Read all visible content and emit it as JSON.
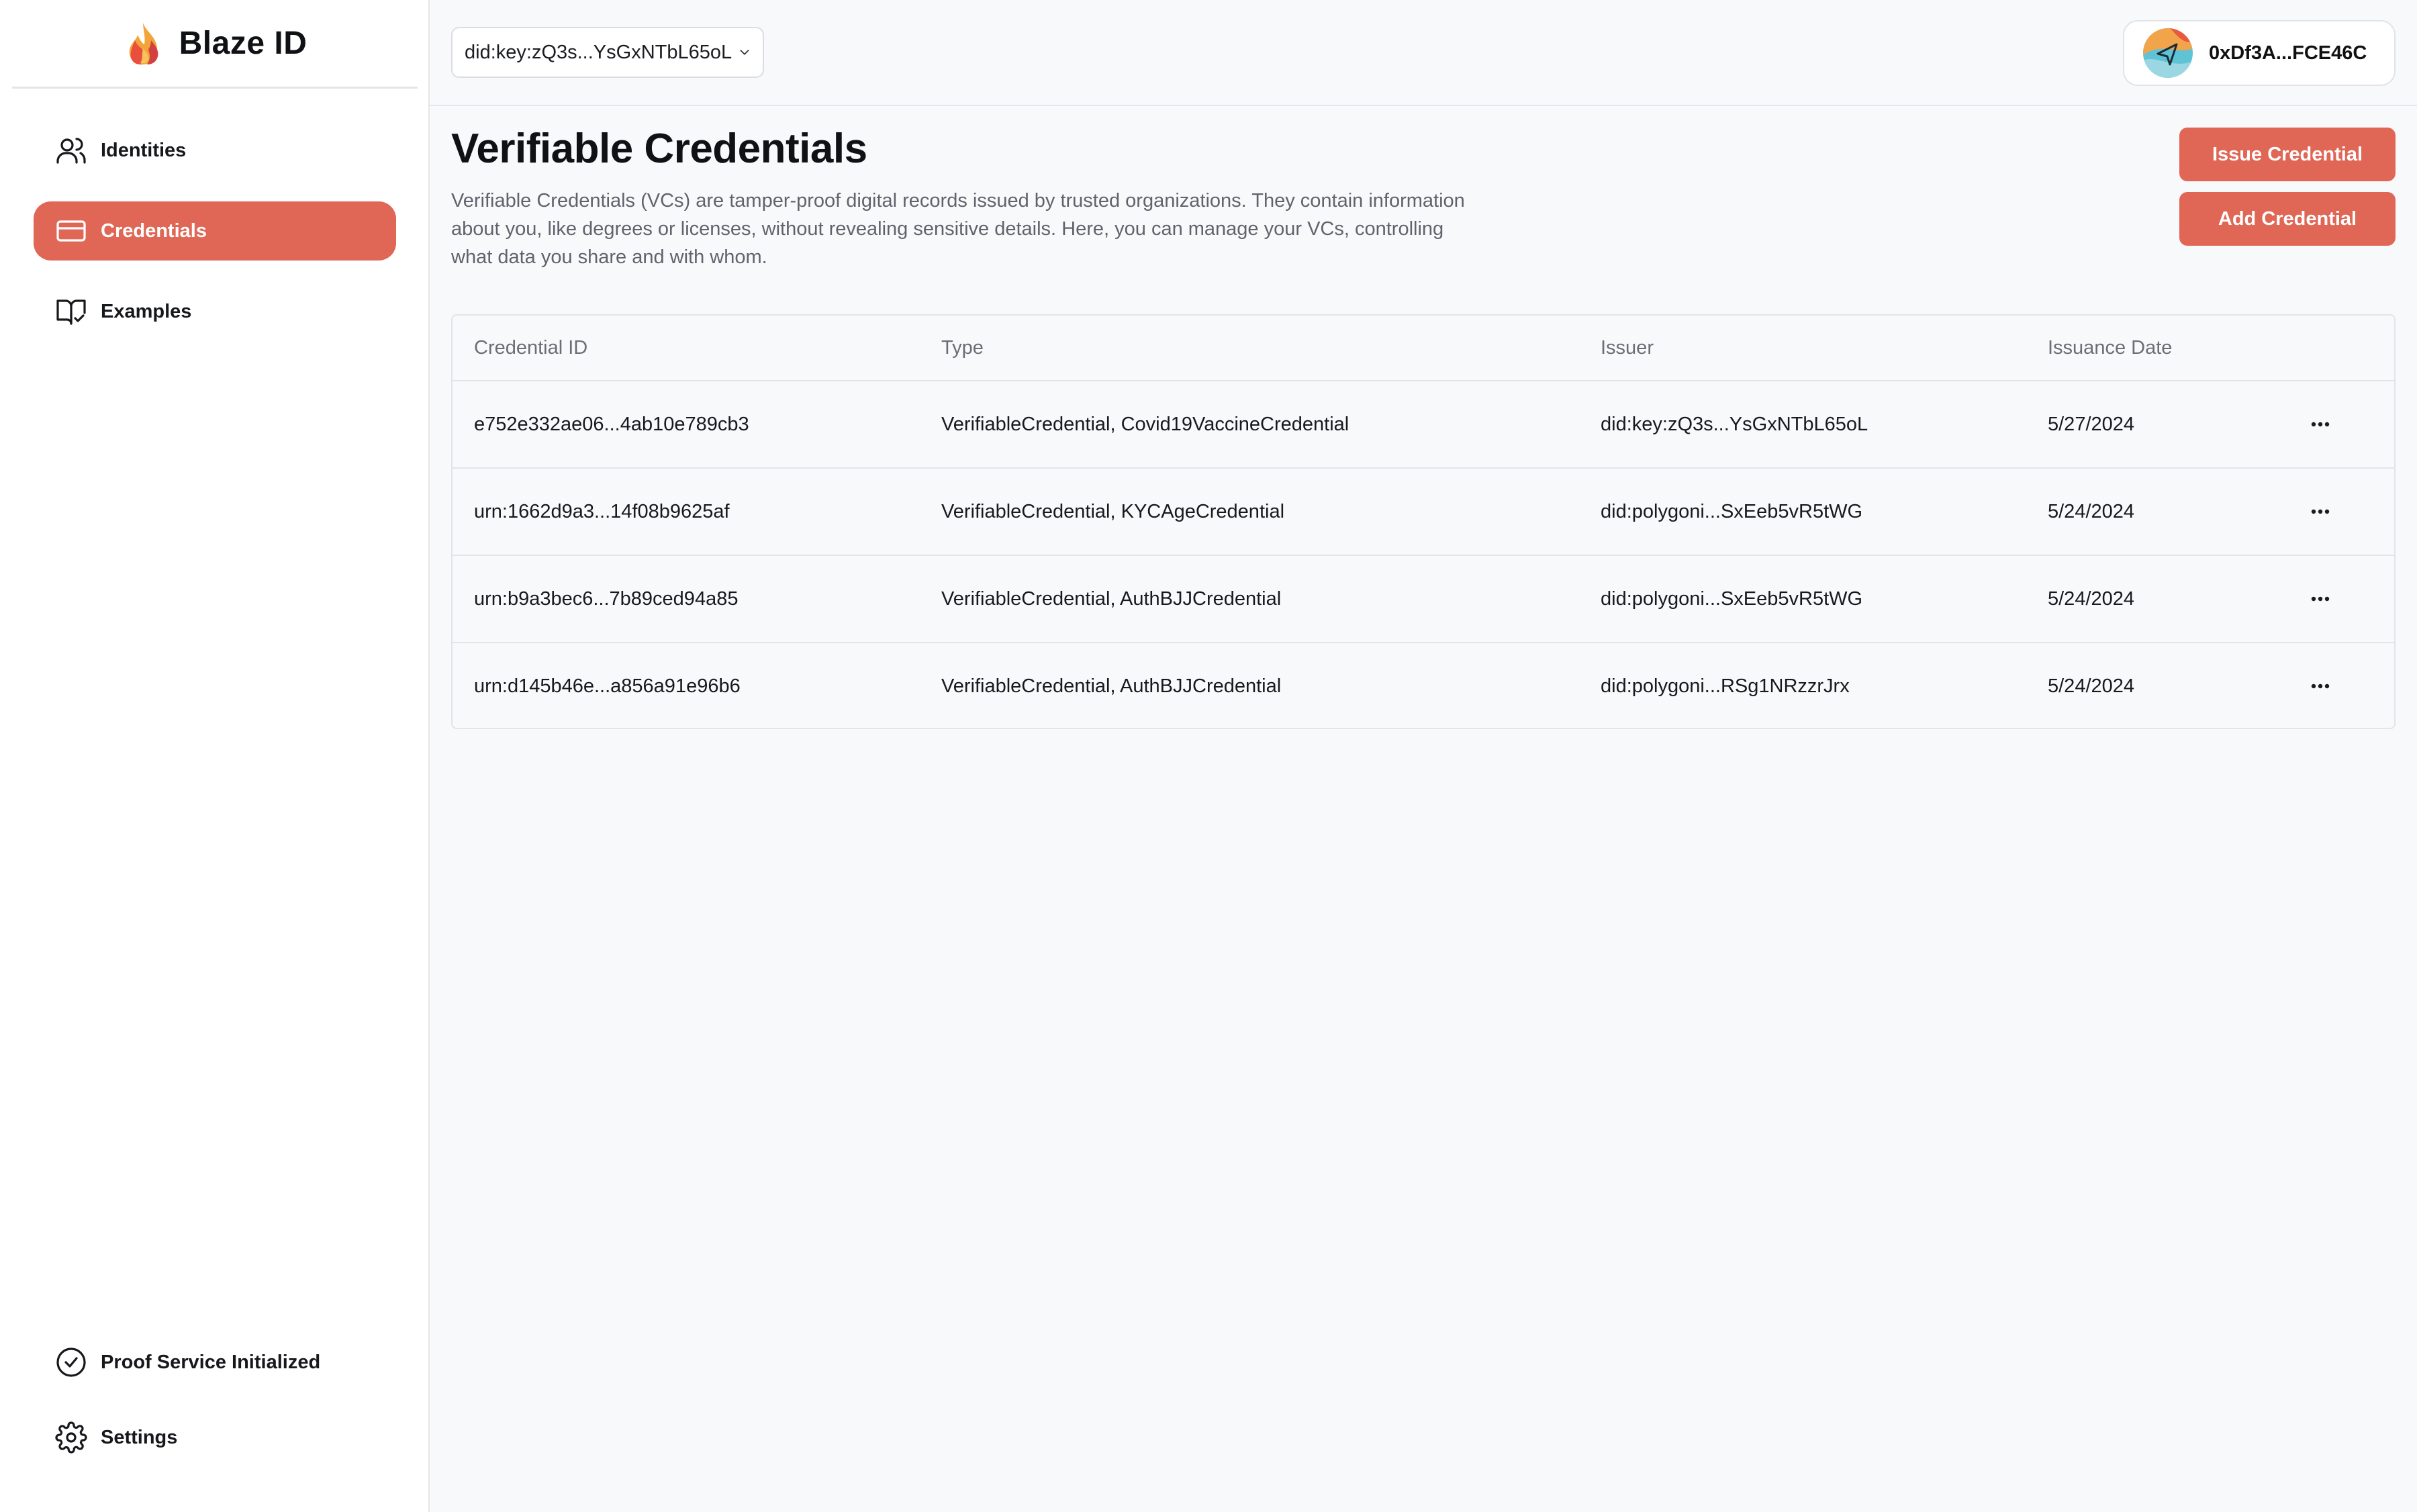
{
  "app": {
    "name": "Blaze ID"
  },
  "sidebar": {
    "items": [
      {
        "label": "Identities",
        "icon": "users-icon",
        "active": false
      },
      {
        "label": "Credentials",
        "icon": "credit-card-icon",
        "active": true
      },
      {
        "label": "Examples",
        "icon": "book-check-icon",
        "active": false
      }
    ],
    "footer": [
      {
        "label": "Proof Service Initialized",
        "icon": "check-circle-icon"
      },
      {
        "label": "Settings",
        "icon": "gear-icon"
      }
    ]
  },
  "topbar": {
    "did_selected": "did:key:zQ3s...YsGxNTbL65oL",
    "wallet_address": "0xDf3A...FCE46C"
  },
  "main": {
    "title": "Verifiable Credentials",
    "description": "Verifiable Credentials (VCs) are tamper-proof digital records issued by trusted organizations. They contain information about you, like degrees or licenses, without revealing sensitive details. Here, you can manage your VCs, controlling what data you share and with whom.",
    "issue_button": "Issue Credential",
    "add_button": "Add Credential"
  },
  "table": {
    "columns": [
      "Credential ID",
      "Type",
      "Issuer",
      "Issuance Date"
    ],
    "rows": [
      [
        "e752e332ae06...4ab10e789cb3",
        "VerifiableCredential, Covid19VaccineCredential",
        "did:key:zQ3s...YsGxNTbL65oL",
        "5/27/2024"
      ],
      [
        "urn:1662d9a3...14f08b9625af",
        "VerifiableCredential, KYCAgeCredential",
        "did:polygoni...SxEeb5vR5tWG",
        "5/24/2024"
      ],
      [
        "urn:b9a3bec6...7b89ced94a85",
        "VerifiableCredential, AuthBJJCredential",
        "did:polygoni...SxEeb5vR5tWG",
        "5/24/2024"
      ],
      [
        "urn:d145b46e...a856a91e96b6",
        "VerifiableCredential, AuthBJJCredential",
        "did:polygoni...RSg1NRzzrJrx",
        "5/24/2024"
      ]
    ]
  },
  "colors": {
    "accent": "#e06656",
    "background": "#f8f9fb",
    "sidebar": "#ffffff"
  }
}
